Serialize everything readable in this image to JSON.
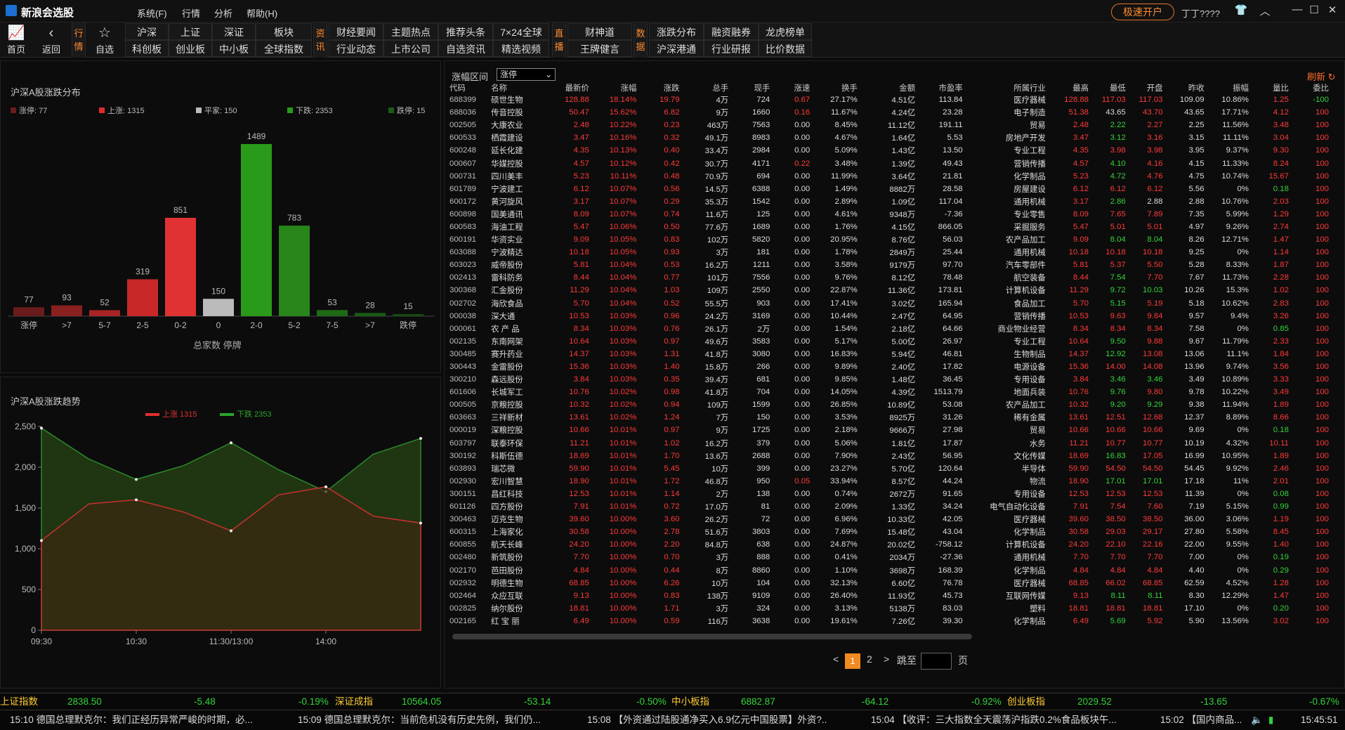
{
  "title_bar": {
    "app_title": "新浪会选股",
    "menus": [
      "系统(F)",
      "行情",
      "分析",
      "帮助(H)"
    ],
    "fast_open": "极速开户",
    "username": "丁丁????"
  },
  "toolbar": {
    "home": "首页",
    "back": "返回",
    "vtab_hq": "行情",
    "watch": "自选",
    "row1": [
      "沪深",
      "上证",
      "深证",
      "板块"
    ],
    "row2": [
      "科创板",
      "创业板",
      "中小板",
      "全球指数"
    ],
    "vtab_zx": "资讯",
    "news_row1": [
      "财经要闻",
      "主题热点",
      "推荐头条",
      "7×24全球"
    ],
    "news_row2": [
      "行业动态",
      "上市公司",
      "自选资讯",
      "精选视频"
    ],
    "vtab_zb": "直播",
    "live_row1": "财神道",
    "live_row2": "王牌健言",
    "vtab_sj": "数据",
    "data_row1": [
      "涨跌分布",
      "融资融券",
      "龙虎榜单"
    ],
    "data_row2": [
      "沪深港通",
      "行业研报",
      "比价数据"
    ]
  },
  "dist_panel": {
    "title": "沪深A股涨跌分布",
    "footer": "总家数  停牌",
    "legend": [
      {
        "label": "涨停: 77",
        "color": "#6a1c1c"
      },
      {
        "label": "上涨: 1315",
        "color": "#e02c2c"
      },
      {
        "label": "平家: 150",
        "color": "#bbbbbb"
      },
      {
        "label": "下跌: 2353",
        "color": "#2a9a1a"
      },
      {
        "label": "跌停: 15",
        "color": "#1e5a17"
      }
    ]
  },
  "trend_panel": {
    "title": "沪深A股涨跌趋势",
    "legend_up": "上涨 1315",
    "legend_down": "下跌 2353"
  },
  "chart_data": [
    {
      "type": "bar",
      "title": "沪深A股涨跌分布",
      "categories": [
        "涨停",
        ">7",
        "5-7",
        "2-5",
        "0-2",
        "0",
        "2-0",
        "5-2",
        "7-5",
        ">7",
        "跌停"
      ],
      "values": [
        77,
        93,
        52,
        319,
        851,
        150,
        1489,
        783,
        53,
        28,
        15
      ],
      "colors": [
        "#6a1c1c",
        "#8a2020",
        "#a82424",
        "#c82828",
        "#e03232",
        "#bbbbbb",
        "#2a9a1a",
        "#28861a",
        "#1f6a16",
        "#1a5a14",
        "#164a12"
      ]
    },
    {
      "type": "area",
      "title": "沪深A股涨跌趋势",
      "x": [
        "09:30",
        "10:00",
        "10:30",
        "11:00",
        "11:30/13:00",
        "13:30",
        "14:00",
        "14:30",
        "15:00"
      ],
      "ylim": [
        0,
        2500
      ],
      "yticks": [
        0,
        500,
        1000,
        1500,
        2000,
        2500
      ],
      "xticks": [
        "09:30",
        "10:30",
        "11:30/13:00",
        "14:00"
      ],
      "series": [
        {
          "name": "下跌",
          "color": "#2a8a2a",
          "values": [
            2480,
            2100,
            1850,
            2020,
            2300,
            1970,
            1700,
            2160,
            2353
          ]
        },
        {
          "name": "上涨",
          "color": "#c83030",
          "values": [
            1100,
            1550,
            1600,
            1450,
            1220,
            1660,
            1760,
            1400,
            1315
          ]
        }
      ]
    }
  ],
  "table": {
    "filter_label": "涨幅区间",
    "filter_value": "涨停",
    "refresh": "刷新",
    "columns": [
      "代码",
      "名称",
      "最新价",
      "涨幅",
      "涨跌",
      "总手",
      "现手",
      "涨速",
      "换手",
      "金额",
      "市盈率",
      "所属行业",
      "最高",
      "最低",
      "开盘",
      "昨收",
      "振幅",
      "量比",
      "委比"
    ],
    "rows": [
      [
        "688399",
        "硕世生物",
        "128.88",
        "18.14%",
        "19.79",
        "4万",
        "724",
        "0.67",
        "27.17%",
        "4.51亿",
        "113.84",
        "医疗器械",
        "128.88",
        "117.03",
        "117.03",
        "109.09",
        "10.86%",
        "1.25",
        "-100"
      ],
      [
        "688036",
        "传音控股",
        "50.47",
        "15.62%",
        "6.82",
        "9万",
        "1660",
        "0.16",
        "11.67%",
        "4.24亿",
        "23.28",
        "电子制造",
        "51.38",
        "43.65",
        "43.70",
        "43.65",
        "17.71%",
        "4.12",
        "100"
      ],
      [
        "002505",
        "大康农业",
        "2.48",
        "10.22%",
        "0.23",
        "463万",
        "7563",
        "0.00",
        "8.45%",
        "11.12亿",
        "191.11",
        "贸易",
        "2.48",
        "2.22",
        "2.27",
        "2.25",
        "11.56%",
        "3.48",
        "100"
      ],
      [
        "600533",
        "栖霞建设",
        "3.47",
        "10.16%",
        "0.32",
        "49.1万",
        "8983",
        "0.00",
        "4.67%",
        "1.64亿",
        "5.53",
        "房地产开发",
        "3.47",
        "3.12",
        "3.16",
        "3.15",
        "11.11%",
        "3.04",
        "100"
      ],
      [
        "600248",
        "延长化建",
        "4.35",
        "10.13%",
        "0.40",
        "33.4万",
        "2984",
        "0.00",
        "5.09%",
        "1.43亿",
        "13.50",
        "专业工程",
        "4.35",
        "3.98",
        "3.98",
        "3.95",
        "9.37%",
        "9.30",
        "100"
      ],
      [
        "000607",
        "华媒控股",
        "4.57",
        "10.12%",
        "0.42",
        "30.7万",
        "4171",
        "0.22",
        "3.48%",
        "1.39亿",
        "49.43",
        "营销传播",
        "4.57",
        "4.10",
        "4.16",
        "4.15",
        "11.33%",
        "8.24",
        "100"
      ],
      [
        "000731",
        "四川美丰",
        "5.23",
        "10.11%",
        "0.48",
        "70.9万",
        "694",
        "0.00",
        "11.99%",
        "3.64亿",
        "21.81",
        "化学制品",
        "5.23",
        "4.72",
        "4.76",
        "4.75",
        "10.74%",
        "15.67",
        "100"
      ],
      [
        "601789",
        "宁波建工",
        "6.12",
        "10.07%",
        "0.56",
        "14.5万",
        "6388",
        "0.00",
        "1.49%",
        "8882万",
        "28.58",
        "房屋建设",
        "6.12",
        "6.12",
        "6.12",
        "5.56",
        "0%",
        "0.18",
        "100"
      ],
      [
        "600172",
        "黄河旋风",
        "3.17",
        "10.07%",
        "0.29",
        "35.3万",
        "1542",
        "0.00",
        "2.89%",
        "1.09亿",
        "117.04",
        "通用机械",
        "3.17",
        "2.86",
        "2.88",
        "2.88",
        "10.76%",
        "2.03",
        "100"
      ],
      [
        "600898",
        "国美通讯",
        "8.09",
        "10.07%",
        "0.74",
        "11.6万",
        "125",
        "0.00",
        "4.61%",
        "9348万",
        "-7.36",
        "专业零售",
        "8.09",
        "7.65",
        "7.89",
        "7.35",
        "5.99%",
        "1.29",
        "100"
      ],
      [
        "600583",
        "海油工程",
        "5.47",
        "10.06%",
        "0.50",
        "77.6万",
        "1689",
        "0.00",
        "1.76%",
        "4.15亿",
        "866.05",
        "采掘服务",
        "5.47",
        "5.01",
        "5.01",
        "4.97",
        "9.26%",
        "2.74",
        "100"
      ],
      [
        "600191",
        "华资实业",
        "9.09",
        "10.05%",
        "0.83",
        "102万",
        "5820",
        "0.00",
        "20.95%",
        "8.76亿",
        "56.03",
        "农产品加工",
        "9.09",
        "8.04",
        "8.04",
        "8.26",
        "12.71%",
        "1.47",
        "100"
      ],
      [
        "603088",
        "宁波精达",
        "10.18",
        "10.05%",
        "0.93",
        "3万",
        "181",
        "0.00",
        "1.78%",
        "2849万",
        "25.44",
        "通用机械",
        "10.18",
        "10.18",
        "10.18",
        "9.25",
        "0%",
        "1.14",
        "100"
      ],
      [
        "603023",
        "威帝股份",
        "5.81",
        "10.04%",
        "0.53",
        "16.2万",
        "1211",
        "0.00",
        "3.58%",
        "9179万",
        "97.70",
        "汽车零部件",
        "5.81",
        "5.37",
        "5.50",
        "5.28",
        "8.33%",
        "1.87",
        "100"
      ],
      [
        "002413",
        "雷科防务",
        "8.44",
        "10.04%",
        "0.77",
        "101万",
        "7556",
        "0.00",
        "9.76%",
        "8.12亿",
        "78.48",
        "航空装备",
        "8.44",
        "7.54",
        "7.70",
        "7.67",
        "11.73%",
        "2.28",
        "100"
      ],
      [
        "300368",
        "汇金股份",
        "11.29",
        "10.04%",
        "1.03",
        "109万",
        "2550",
        "0.00",
        "22.87%",
        "11.36亿",
        "173.81",
        "计算机设备",
        "11.29",
        "9.72",
        "10.03",
        "10.26",
        "15.3%",
        "1.02",
        "100"
      ],
      [
        "002702",
        "海欣食品",
        "5.70",
        "10.04%",
        "0.52",
        "55.5万",
        "903",
        "0.00",
        "17.41%",
        "3.02亿",
        "165.94",
        "食品加工",
        "5.70",
        "5.15",
        "5.19",
        "5.18",
        "10.62%",
        "2.83",
        "100"
      ],
      [
        "000038",
        "深大通",
        "10.53",
        "10.03%",
        "0.96",
        "24.2万",
        "3169",
        "0.00",
        "10.44%",
        "2.47亿",
        "64.95",
        "营销传播",
        "10.53",
        "9.63",
        "9.84",
        "9.57",
        "9.4%",
        "3.26",
        "100"
      ],
      [
        "000061",
        "农 产 品",
        "8.34",
        "10.03%",
        "0.76",
        "26.1万",
        "2万",
        "0.00",
        "1.54%",
        "2.18亿",
        "64.66",
        "商业物业经营",
        "8.34",
        "8.34",
        "8.34",
        "7.58",
        "0%",
        "0.85",
        "100"
      ],
      [
        "002135",
        "东南网架",
        "10.64",
        "10.03%",
        "0.97",
        "49.6万",
        "3583",
        "0.00",
        "5.17%",
        "5.00亿",
        "26.97",
        "专业工程",
        "10.64",
        "9.50",
        "9.88",
        "9.67",
        "11.79%",
        "2.33",
        "100"
      ],
      [
        "300485",
        "赛升药业",
        "14.37",
        "10.03%",
        "1.31",
        "41.8万",
        "3080",
        "0.00",
        "16.83%",
        "5.94亿",
        "46.81",
        "生物制品",
        "14.37",
        "12.92",
        "13.08",
        "13.06",
        "11.1%",
        "1.84",
        "100"
      ],
      [
        "300443",
        "金雷股份",
        "15.36",
        "10.03%",
        "1.40",
        "15.8万",
        "266",
        "0.00",
        "9.89%",
        "2.40亿",
        "17.82",
        "电源设备",
        "15.36",
        "14.00",
        "14.08",
        "13.96",
        "9.74%",
        "3.56",
        "100"
      ],
      [
        "300210",
        "森远股份",
        "3.84",
        "10.03%",
        "0.35",
        "39.4万",
        "681",
        "0.00",
        "9.85%",
        "1.48亿",
        "36.45",
        "专用设备",
        "3.84",
        "3.46",
        "3.46",
        "3.49",
        "10.89%",
        "3.33",
        "100"
      ],
      [
        "601606",
        "长城军工",
        "10.76",
        "10.02%",
        "0.98",
        "41.8万",
        "704",
        "0.00",
        "14.05%",
        "4.39亿",
        "1513.79",
        "地面兵装",
        "10.76",
        "9.76",
        "9.80",
        "9.78",
        "10.22%",
        "3.49",
        "100"
      ],
      [
        "000505",
        "京粮控股",
        "10.32",
        "10.02%",
        "0.94",
        "109万",
        "1599",
        "0.00",
        "26.85%",
        "10.89亿",
        "53.08",
        "农产品加工",
        "10.32",
        "9.20",
        "9.29",
        "9.38",
        "11.94%",
        "1.89",
        "100"
      ],
      [
        "603663",
        "三祥新材",
        "13.61",
        "10.02%",
        "1.24",
        "7万",
        "150",
        "0.00",
        "3.53%",
        "8925万",
        "31.26",
        "稀有金属",
        "13.61",
        "12.51",
        "12.68",
        "12.37",
        "8.89%",
        "8.66",
        "100"
      ],
      [
        "000019",
        "深粮控股",
        "10.66",
        "10.01%",
        "0.97",
        "9万",
        "1725",
        "0.00",
        "2.18%",
        "9666万",
        "27.98",
        "贸易",
        "10.66",
        "10.66",
        "10.66",
        "9.69",
        "0%",
        "0.18",
        "100"
      ],
      [
        "603797",
        "联泰环保",
        "11.21",
        "10.01%",
        "1.02",
        "16.2万",
        "379",
        "0.00",
        "5.06%",
        "1.81亿",
        "17.87",
        "水务",
        "11.21",
        "10.77",
        "10.77",
        "10.19",
        "4.32%",
        "10.11",
        "100"
      ],
      [
        "300192",
        "科斯伍德",
        "18.69",
        "10.01%",
        "1.70",
        "13.6万",
        "2688",
        "0.00",
        "7.90%",
        "2.43亿",
        "56.95",
        "文化传媒",
        "18.69",
        "16.83",
        "17.05",
        "16.99",
        "10.95%",
        "1.89",
        "100"
      ],
      [
        "603893",
        "瑞芯微",
        "59.90",
        "10.01%",
        "5.45",
        "10万",
        "399",
        "0.00",
        "23.27%",
        "5.70亿",
        "120.64",
        "半导体",
        "59.90",
        "54.50",
        "54.50",
        "54.45",
        "9.92%",
        "2.46",
        "100"
      ],
      [
        "002930",
        "宏川智慧",
        "18.90",
        "10.01%",
        "1.72",
        "46.8万",
        "950",
        "0.05",
        "33.94%",
        "8.57亿",
        "44.24",
        "物流",
        "18.90",
        "17.01",
        "17.01",
        "17.18",
        "11%",
        "2.01",
        "100"
      ],
      [
        "300151",
        "昌红科技",
        "12.53",
        "10.01%",
        "1.14",
        "2万",
        "138",
        "0.00",
        "0.74%",
        "2672万",
        "91.65",
        "专用设备",
        "12.53",
        "12.53",
        "12.53",
        "11.39",
        "0%",
        "0.08",
        "100"
      ],
      [
        "601126",
        "四方股份",
        "7.91",
        "10.01%",
        "0.72",
        "17.0万",
        "81",
        "0.00",
        "2.09%",
        "1.33亿",
        "34.24",
        "电气自动化设备",
        "7.91",
        "7.54",
        "7.60",
        "7.19",
        "5.15%",
        "0.99",
        "100"
      ],
      [
        "300463",
        "迈克生物",
        "39.60",
        "10.00%",
        "3.60",
        "26.2万",
        "72",
        "0.00",
        "6.96%",
        "10.33亿",
        "42.05",
        "医疗器械",
        "39.60",
        "38.50",
        "38.50",
        "36.00",
        "3.06%",
        "1.19",
        "100"
      ],
      [
        "600315",
        "上海家化",
        "30.58",
        "10.00%",
        "2.78",
        "51.6万",
        "3803",
        "0.00",
        "7.69%",
        "15.48亿",
        "43.04",
        "化学制品",
        "30.58",
        "29.03",
        "29.17",
        "27.80",
        "5.58%",
        "8.45",
        "100"
      ],
      [
        "600855",
        "航天长峰",
        "24.20",
        "10.00%",
        "2.20",
        "84.8万",
        "638",
        "0.00",
        "24.87%",
        "20.02亿",
        "-758.12",
        "计算机设备",
        "24.20",
        "22.10",
        "22.16",
        "22.00",
        "9.55%",
        "1.40",
        "100"
      ],
      [
        "002480",
        "新筑股份",
        "7.70",
        "10.00%",
        "0.70",
        "3万",
        "888",
        "0.00",
        "0.41%",
        "2034万",
        "-27.36",
        "通用机械",
        "7.70",
        "7.70",
        "7.70",
        "7.00",
        "0%",
        "0.19",
        "100"
      ],
      [
        "002170",
        "芭田股份",
        "4.84",
        "10.00%",
        "0.44",
        "8万",
        "8860",
        "0.00",
        "1.10%",
        "3698万",
        "168.39",
        "化学制品",
        "4.84",
        "4.84",
        "4.84",
        "4.40",
        "0%",
        "0.29",
        "100"
      ],
      [
        "002932",
        "明德生物",
        "68.85",
        "10.00%",
        "6.26",
        "10万",
        "104",
        "0.00",
        "32.13%",
        "6.60亿",
        "76.78",
        "医疗器械",
        "68.85",
        "66.02",
        "68.85",
        "62.59",
        "4.52%",
        "1.28",
        "100"
      ],
      [
        "002464",
        "众应互联",
        "9.13",
        "10.00%",
        "0.83",
        "138万",
        "9109",
        "0.00",
        "26.40%",
        "11.93亿",
        "45.73",
        "互联网传媒",
        "9.13",
        "8.11",
        "8.11",
        "8.30",
        "12.29%",
        "1.47",
        "100"
      ],
      [
        "002825",
        "纳尔股份",
        "18.81",
        "10.00%",
        "1.71",
        "3万",
        "324",
        "0.00",
        "3.13%",
        "5138万",
        "83.03",
        "塑料",
        "18.81",
        "18.81",
        "18.81",
        "17.10",
        "0%",
        "0.20",
        "100"
      ],
      [
        "002165",
        "红 宝 丽",
        "6.49",
        "10.00%",
        "0.59",
        "116万",
        "3638",
        "0.00",
        "19.61%",
        "7.26亿",
        "39.30",
        "化学制品",
        "6.49",
        "5.69",
        "5.92",
        "5.90",
        "13.56%",
        "3.02",
        "100"
      ]
    ]
  },
  "pager": {
    "prev": "<",
    "page1": "1",
    "page2": "2",
    "next": ">",
    "goto": "跳至",
    "unit": "页"
  },
  "index_bar": [
    {
      "name": "上证指数",
      "value": "2838.50",
      "change": "-5.48",
      "pct": "-0.19%"
    },
    {
      "name": "深证成指",
      "value": "10564.05",
      "change": "-53.14",
      "pct": "-0.50%"
    },
    {
      "name": "中小板指",
      "value": "6882.87",
      "change": "-64.12",
      "pct": "-0.92%"
    },
    {
      "name": "创业板指",
      "value": "2029.52",
      "change": "-13.65",
      "pct": "-0.67%"
    }
  ],
  "news_bar": {
    "items": [
      {
        "time": "15:10",
        "text": "德国总理默克尔：我们正经历异常严峻的时期，必..."
      },
      {
        "time": "15:09",
        "text": "德国总理默克尔：当前危机没有历史先例，我们仍..."
      },
      {
        "time": "15:08",
        "text": "【外资通过陆股通净买入6.9亿元中国股票】外资?.."
      },
      {
        "time": "15:04",
        "text": "【收评：三大指数全天震荡沪指跌0.2%食品板块午..."
      },
      {
        "time": "15:02",
        "text": "【国内商品..."
      }
    ],
    "clock": "15:45:51"
  }
}
